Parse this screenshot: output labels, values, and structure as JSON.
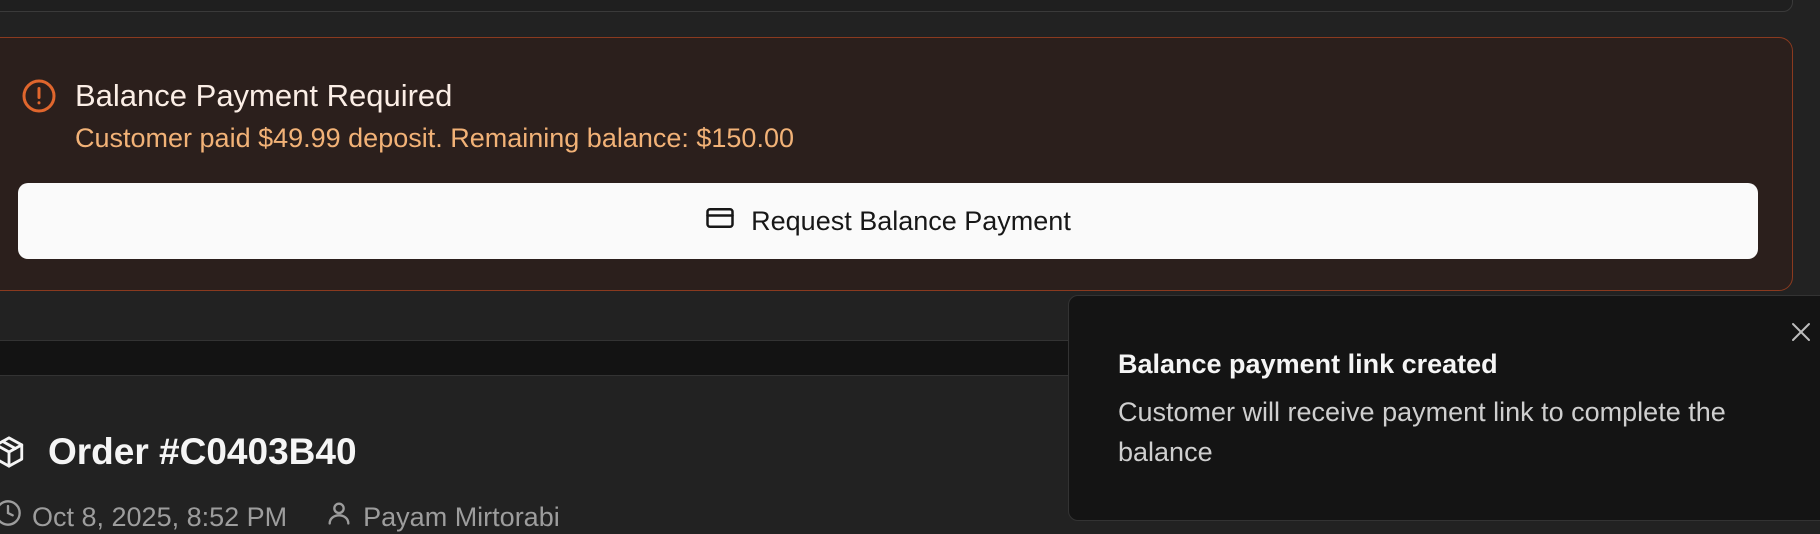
{
  "alert": {
    "title": "Balance Payment Required",
    "description": "Customer paid $49.99 deposit. Remaining balance: $150.00",
    "button_label": "Request Balance Payment",
    "icon": "alert-circle-icon",
    "accent_color": "#e0662d"
  },
  "order": {
    "title": "Order #C0403B40",
    "datetime": "Oct 8, 2025, 8:52 PM",
    "customer": "Payam Mirtorabi",
    "icon": "package-icon"
  },
  "toast": {
    "title": "Balance payment link created",
    "description": "Customer will receive payment link to complete the balance",
    "close_icon": "close-icon"
  }
}
